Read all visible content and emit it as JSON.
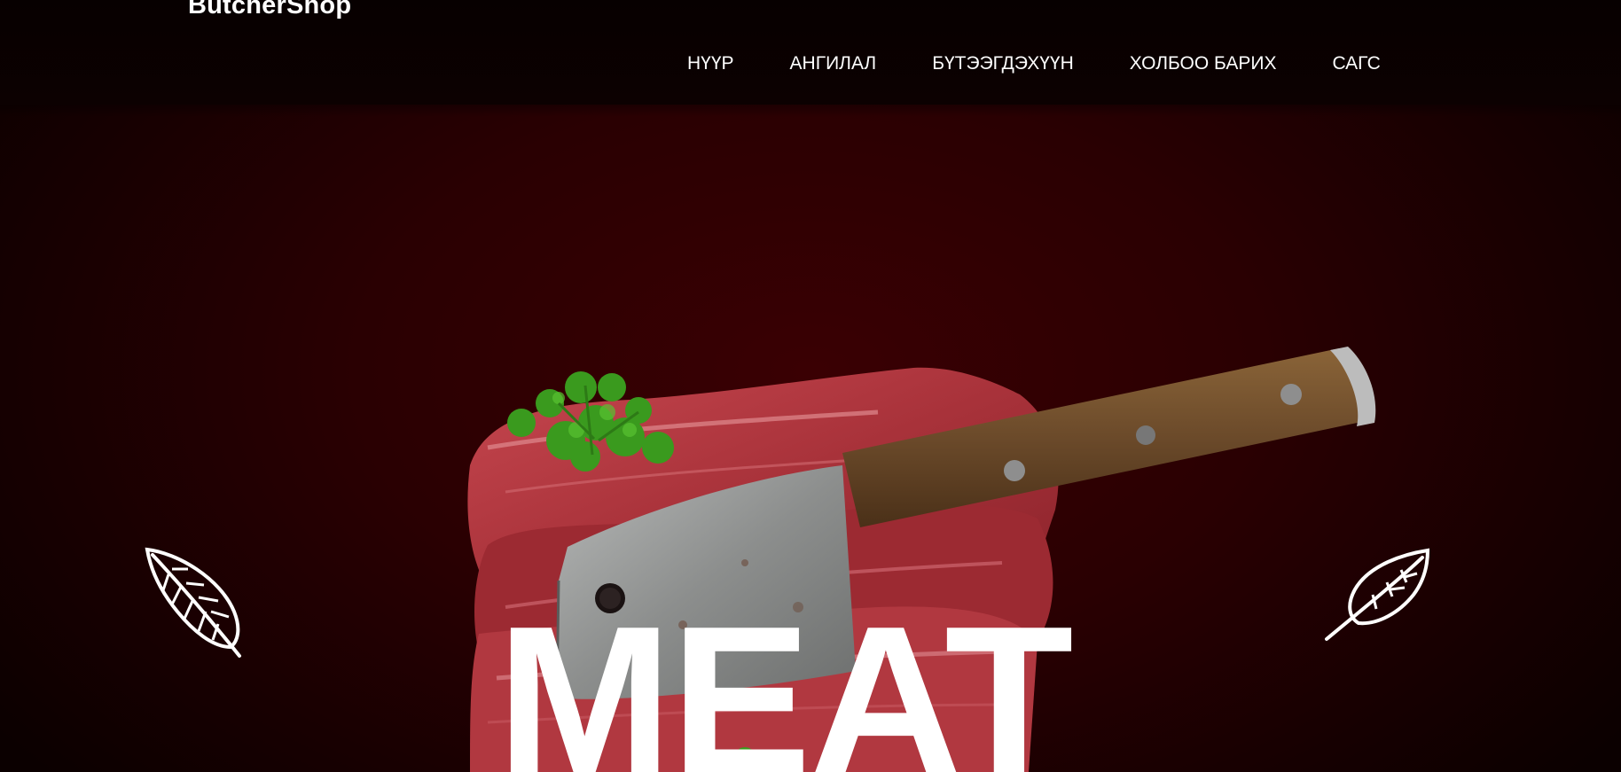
{
  "brand": {
    "logo_text": "ButcherShop"
  },
  "nav": {
    "items": [
      {
        "label": "НҮҮР"
      },
      {
        "label": "АНГИЛАЛ"
      },
      {
        "label": "БҮТЭЭГДЭХҮҮН"
      },
      {
        "label": "ХОЛБОО БАРИХ"
      },
      {
        "label": "САГС"
      }
    ]
  },
  "hero": {
    "title": "MEAT",
    "image": "meat-with-cleaver-and-parsley",
    "left_decoration": "leaf-icon",
    "right_decoration": "leaf-icon"
  },
  "colors": {
    "background": "#2a0002",
    "header": "#0a0001",
    "text": "#ffffff",
    "meat": "#b83a40",
    "parsley": "#3a9a1e",
    "blade": "#8d8f8f",
    "handle": "#6b4a2a"
  }
}
